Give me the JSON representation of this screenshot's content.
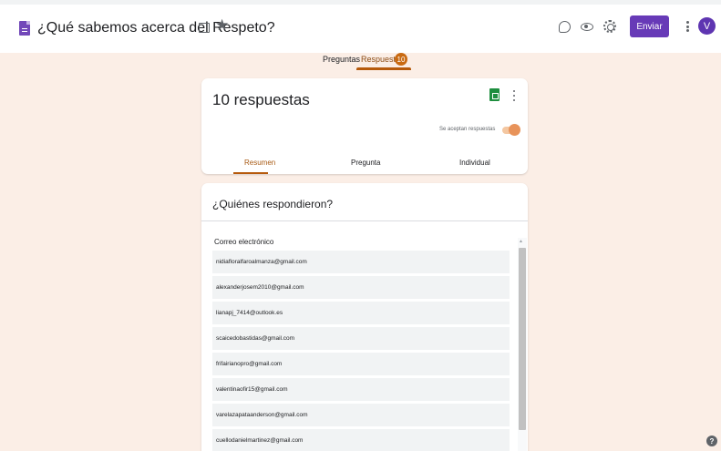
{
  "header": {
    "title": "¿Qué sabemos acerca del Respeto?",
    "send_label": "Enviar",
    "avatar_initial": "V",
    "accent_color": "#673ab7"
  },
  "tabs": {
    "questions": "Preguntas",
    "responses": "Respuestas",
    "responses_count": "10",
    "active": "responses"
  },
  "summary": {
    "title": "10 respuestas",
    "accepting_label": "Se aceptan respuestas",
    "accepting": true,
    "subtabs": [
      "Resumen",
      "Pregunta",
      "Individual"
    ],
    "active_subtab": "Resumen"
  },
  "respondents": {
    "title": "¿Quiénes respondieron?",
    "column_label": "Correo electrónico",
    "emails": [
      "nidiafloralfaroalmanza@gmail.com",
      "alexanderjosem2010@gmail.com",
      "lianapj_7414@outlook.es",
      "scaicedobastidas@gmail.com",
      "frifairianopro@gmail.com",
      "valentinaofir15@gmail.com",
      "varelazapataanderson@gmail.com",
      "cuellodanielmartinez@gmail.com"
    ]
  },
  "icons": [
    "forms-doc-icon",
    "folder-icon",
    "star-icon",
    "palette-icon",
    "eye-icon",
    "gear-icon",
    "more-vert-icon",
    "sheets-icon",
    "help-icon"
  ]
}
